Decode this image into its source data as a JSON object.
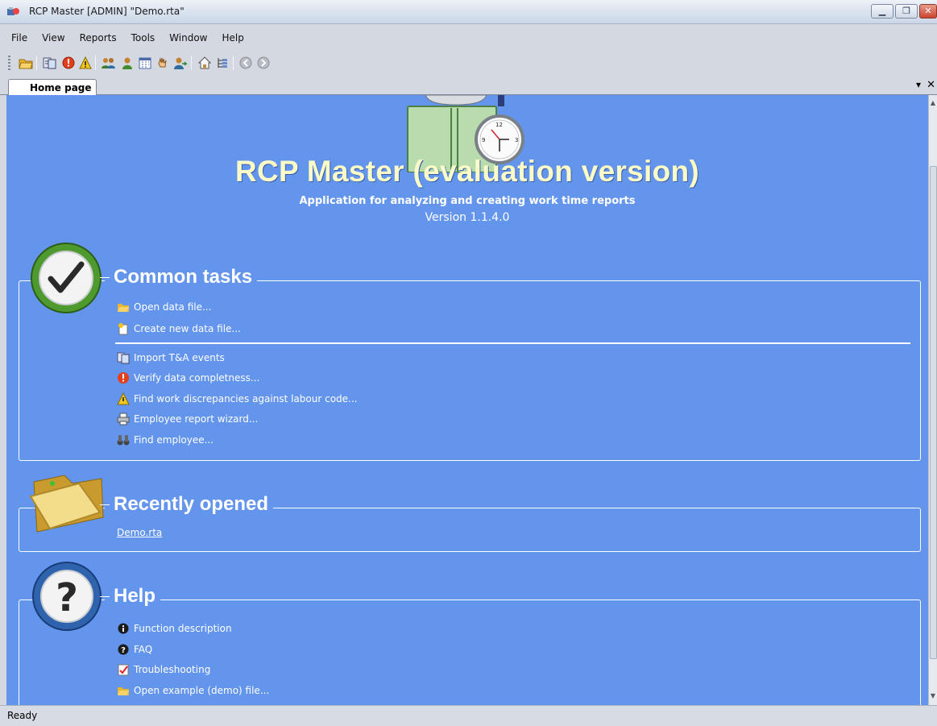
{
  "window": {
    "title": "RCP Master [ADMIN] \"Demo.rta\""
  },
  "menu": [
    "File",
    "View",
    "Reports",
    "Tools",
    "Window",
    "Help"
  ],
  "toolbar": {
    "icons": [
      "open-folder-icon",
      "import-icon",
      "verify-icon",
      "warning-icon",
      "employees-icon",
      "employee-icon",
      "calendar-icon",
      "hand-icon",
      "user-arrow-icon",
      "home-icon",
      "tree-icon",
      "back-icon",
      "forward-icon"
    ]
  },
  "tabs": {
    "active": "Home page"
  },
  "hero": {
    "title": "RCP Master (evaluation version)",
    "subtitle": "Application for analyzing and creating work time reports",
    "version": "Version 1.1.4.0"
  },
  "common_tasks": {
    "title": "Common tasks",
    "items": [
      "Open data file...",
      "Create new data file...",
      "Import T&A events",
      "Verify data completness...",
      "Find work discrepancies against labour code...",
      "Employee report wizard...",
      "Find employee..."
    ]
  },
  "recent": {
    "title": "Recently opened",
    "files": [
      "Demo.rta"
    ]
  },
  "help": {
    "title": "Help",
    "items": [
      "Function description",
      "FAQ",
      "Troubleshooting",
      "Open example (demo) file..."
    ]
  },
  "status": {
    "text": "Ready"
  },
  "colors": {
    "content_bg": "#6495ed",
    "title_text": "#fbfbc8"
  }
}
